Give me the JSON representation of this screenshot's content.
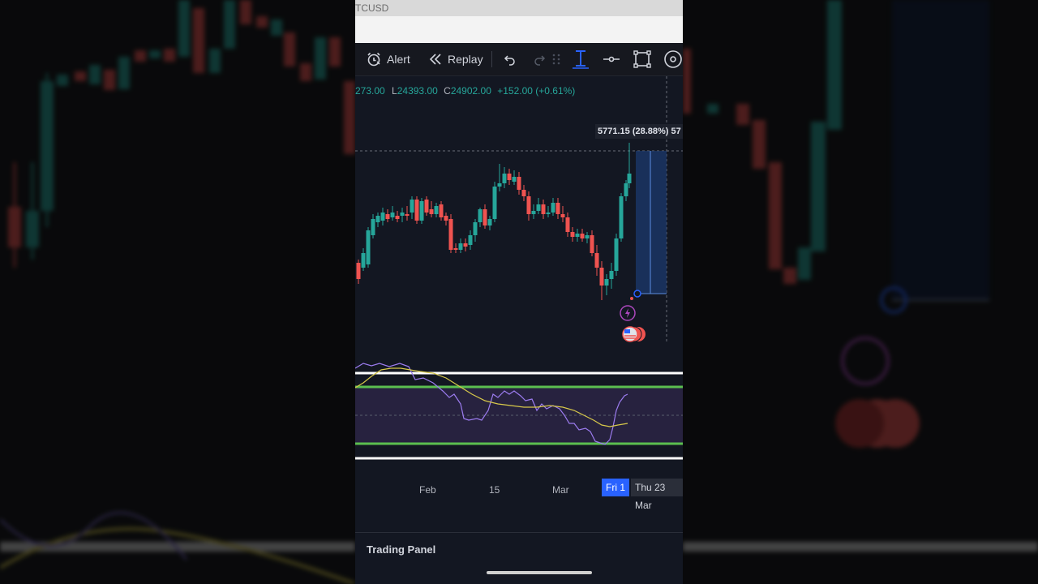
{
  "status_bar": {
    "title": "TCUSD"
  },
  "toolbar": {
    "alert_label": "Alert",
    "replay_label": "Replay",
    "icons": [
      "alarm-clock-icon",
      "rewind-icon",
      "undo-icon",
      "redo-icon",
      "drag-grip-icon",
      "cursor-crosshair-icon",
      "horizontal-line-icon",
      "rectangle-icon",
      "target-icon"
    ]
  },
  "ohlc": {
    "high_fragment": "273.00",
    "low_key": "L",
    "low_value": "24393.00",
    "close_key": "C",
    "close_value": "24902.00",
    "change": "+152.00 (+0.61%)"
  },
  "measure": {
    "label": "5771.15 (28.88%) 57"
  },
  "time_axis": {
    "ticks": [
      "Feb",
      "15",
      "Mar"
    ],
    "highlight_current": "Fri 1",
    "highlight_cursor": "Thu 23 Mar"
  },
  "bottom": {
    "panel_label": "Trading Panel"
  },
  "colors": {
    "up": "#26a69a",
    "down": "#ef5350",
    "rsi_line": "#9c7cf0",
    "ma_line": "#d8c94a",
    "band_green": "#5bbf4f",
    "accent_blue": "#2962ff"
  },
  "badges": [
    "lightning-event-icon",
    "us-flag-events-icon"
  ]
}
